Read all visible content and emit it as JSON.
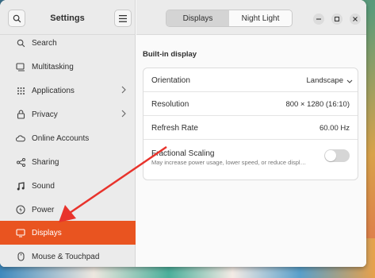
{
  "sidebar": {
    "title": "Settings",
    "items": [
      {
        "label": "Search",
        "icon": "search-icon"
      },
      {
        "label": "Multitasking",
        "icon": "multitasking-icon"
      },
      {
        "label": "Applications",
        "icon": "apps-grid-icon",
        "has_arrow": true
      },
      {
        "label": "Privacy",
        "icon": "lock-icon",
        "has_arrow": true
      },
      {
        "label": "Online Accounts",
        "icon": "cloud-icon"
      },
      {
        "label": "Sharing",
        "icon": "share-icon"
      },
      {
        "label": "Sound",
        "icon": "music-note-icon"
      },
      {
        "label": "Power",
        "icon": "power-icon"
      },
      {
        "label": "Displays",
        "icon": "display-icon",
        "active": true
      },
      {
        "label": "Mouse & Touchpad",
        "icon": "mouse-icon"
      }
    ]
  },
  "header": {
    "tabs": [
      {
        "label": "Displays",
        "selected": true
      },
      {
        "label": "Night Light",
        "selected": false
      }
    ]
  },
  "main": {
    "section_title": "Built-in display",
    "orientation": {
      "label": "Orientation",
      "value": "Landscape"
    },
    "resolution": {
      "label": "Resolution",
      "value": "800 × 1280 (16:10)"
    },
    "refresh_rate": {
      "label": "Refresh Rate",
      "value": "60.00 Hz"
    },
    "fractional_scaling": {
      "label": "Fractional Scaling",
      "description": "May increase power usage, lower speed, or reduce displ…",
      "enabled": false
    }
  },
  "colors": {
    "accent": "#e95420",
    "annotation_arrow": "#e8332c"
  }
}
